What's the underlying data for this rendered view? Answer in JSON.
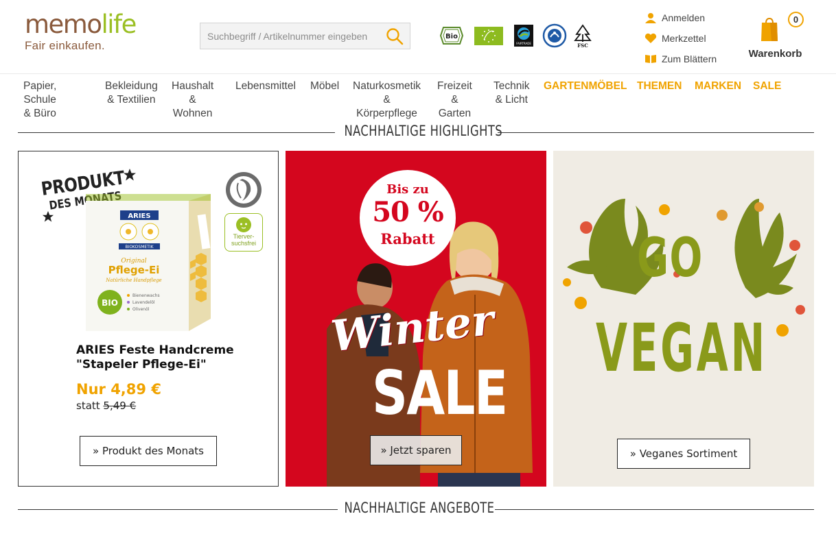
{
  "logo": {
    "part1": "memo",
    "part2": "life",
    "tagline": "Fair einkaufen."
  },
  "search": {
    "placeholder": "Suchbegriff / Artikelnummer eingeben"
  },
  "certifications": [
    "bio-seal-icon",
    "eu-organic-leaf-icon",
    "fairtrade-icon",
    "blue-angel-icon",
    "fsc-tree-icon"
  ],
  "cert_labels": {
    "bio": "Bio",
    "fairtrade": "FAIRTRADE",
    "fsc": "FSC"
  },
  "account": {
    "login": "Anmelden",
    "wishlist": "Merkzettel",
    "browse": "Zum Blättern"
  },
  "cart": {
    "count": "0",
    "label": "Warenkorb"
  },
  "nav": [
    {
      "label": "Papier, Schule\n& Büro"
    },
    {
      "label": "Bekleidung\n& Textilien"
    },
    {
      "label": "Haushalt\n& Wohnen"
    },
    {
      "label": "Lebensmittel"
    },
    {
      "label": "Möbel"
    },
    {
      "label": "Naturkosmetik\n& Körperpflege"
    },
    {
      "label": "Freizeit\n& Garten"
    },
    {
      "label": "Technik\n& Licht"
    },
    {
      "label": "GARTENMÖBEL"
    },
    {
      "label": "THEMEN"
    },
    {
      "label": "MARKEN"
    },
    {
      "label": "SALE"
    }
  ],
  "sections": {
    "highlights": "Nachhaltige Highlights",
    "offers": "Nachhaltige Angebote"
  },
  "product_of_month": {
    "badge_line1": "PRODUKT",
    "badge_line2": "DES MONATS",
    "box_brand": "ARIES",
    "box_sub": "BIOKOSMETIK",
    "box_line1": "Original",
    "box_line2": "Pflege-Ei",
    "box_line3": "Natürliche Handpflege",
    "box_bio": "BIO",
    "box_ingredients": [
      "Bienenwachs",
      "Lavendelöl",
      "Olivenöl"
    ],
    "tierversuchsfrei": "Tierver-\nsuchsfrei",
    "name": "ARIES Feste Handcreme\n \"Stapeler Pflege-Ei\"",
    "price": "Nur 4,89 €",
    "old_prefix": "statt ",
    "old_price": "5,49 €",
    "cta": "» Produkt des Monats"
  },
  "winter_sale": {
    "badge_line1": "Bis zu",
    "badge_line2": "50 %",
    "badge_line3": "Rabatt",
    "headline1": "Winter",
    "headline2": "SALE",
    "cta": "» Jetzt sparen"
  },
  "vegan": {
    "headline1": "GO",
    "headline2": "VEGAN",
    "cta": "» Veganes Sortiment"
  },
  "colors": {
    "accent": "#f0a300",
    "brand_brown": "#8a5a3c",
    "brand_green": "#9bbf24",
    "sale_red": "#d4061e",
    "vegan_green": "#8a9a1a"
  }
}
